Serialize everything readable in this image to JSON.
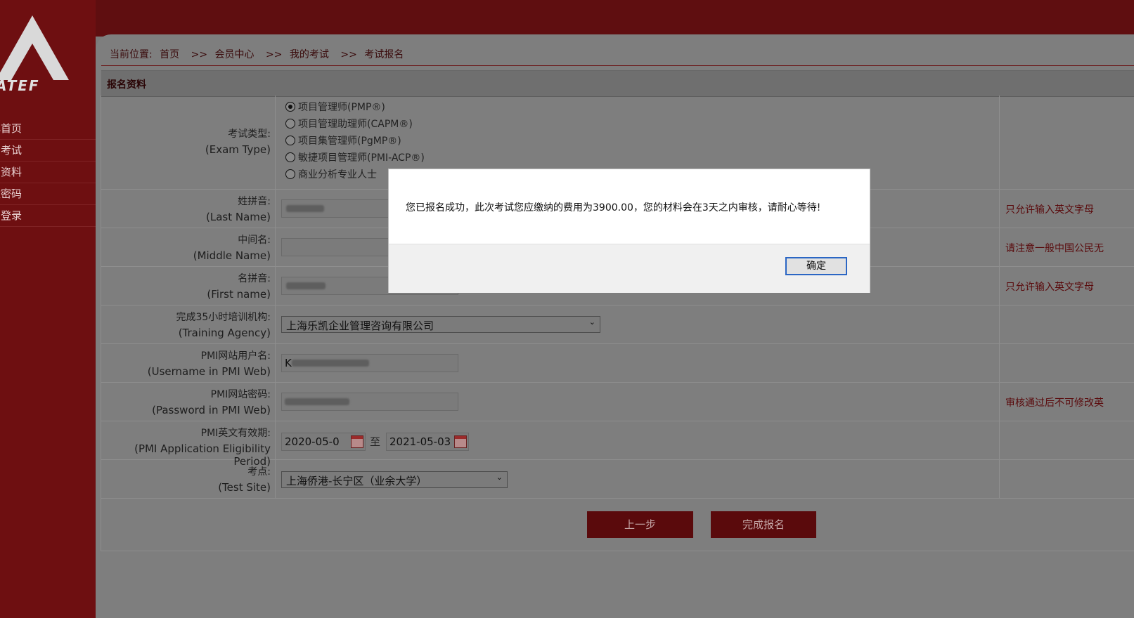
{
  "sidebar": {
    "logo_text": "ATEF",
    "items": [
      {
        "label": "心首页"
      },
      {
        "label": "的考试"
      },
      {
        "label": "的资料"
      },
      {
        "label": "改密码"
      },
      {
        "label": "出登录"
      }
    ]
  },
  "breadcrumb": {
    "prefix": "当前位置:",
    "items": [
      "首页",
      "会员中心",
      "我的考试",
      "考试报名"
    ],
    "separator": ">>"
  },
  "section": {
    "title": "报名资料"
  },
  "form": {
    "exam_type": {
      "cn": "考试类型:",
      "en": "(Exam Type)",
      "options": [
        {
          "label": "项目管理师(PMP®)",
          "checked": true
        },
        {
          "label": "项目管理助理师(CAPM®)",
          "checked": false
        },
        {
          "label": "项目集管理师(PgMP®)",
          "checked": false
        },
        {
          "label": "敏捷项目管理师(PMI-ACP®)",
          "checked": false
        },
        {
          "label": "商业分析专业人士",
          "checked": false
        }
      ]
    },
    "last_name": {
      "cn": "姓拼音:",
      "en": "(Last Name)",
      "note": "只允许输入英文字母"
    },
    "middle_name": {
      "cn": "中间名:",
      "en": "(Middle Name)",
      "note": "请注意一般中国公民无"
    },
    "first_name": {
      "cn": "名拼音:",
      "en": "(First name)",
      "note": "只允许输入英文字母"
    },
    "training_agency": {
      "cn": "完成35小时培训机构:",
      "en": "(Training Agency)",
      "value": "上海乐凯企业管理咨询有限公司"
    },
    "pmi_username": {
      "cn": "PMI网站用户名:",
      "en": "(Username in PMI Web)",
      "value": "K"
    },
    "pmi_password": {
      "cn": "PMI网站密码:",
      "en": "(Password in PMI Web)",
      "note": "审核通过后不可修改英"
    },
    "eligibility": {
      "cn": "PMI英文有效期:",
      "en": "(PMI Application Eligibility Period)",
      "from": "2020-05-0",
      "to_label": "至",
      "to": "2021-05-03"
    },
    "test_site": {
      "cn": "考点:",
      "en": "(Test Site)",
      "value": "上海侨港-长宁区（业余大学）"
    }
  },
  "buttons": {
    "prev": "上一步",
    "submit": "完成报名"
  },
  "dialog": {
    "message": "您已报名成功，此次考试您应缴纳的费用为3900.00，您的材料会在3天之内审核，请耐心等待!",
    "ok_label": "确定"
  }
}
